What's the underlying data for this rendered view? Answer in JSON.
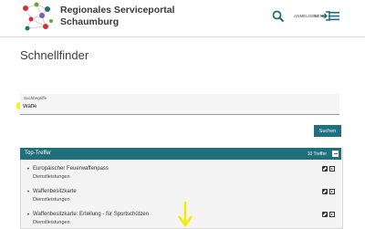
{
  "header": {
    "site_title": "Regionales Serviceportal Schaumburg",
    "login_label": "ANMELDEN",
    "menu_label": "MENÜ",
    "accent": "#1f6f7c"
  },
  "page": {
    "title": "Schnellfinder"
  },
  "search": {
    "label": "Suchbegriffe",
    "value": "Waffe"
  },
  "submit": {
    "label": "Suchen"
  },
  "results": {
    "title": "Top-Treffer",
    "count": "10 Treffer",
    "items": [
      {
        "title": "Europäischer Feuerwaffenpass",
        "category": "Dienstleistungen"
      },
      {
        "title": "Waffenbesitzkarte",
        "category": "Dienstleistungen"
      },
      {
        "title": "Waffenbesitzkarte: Erteilung - für Sportschützen",
        "category": "Dienstleistungen"
      }
    ]
  },
  "icons": {
    "logo": "network-logo-icon",
    "search": "search-icon",
    "login": "login-icon",
    "menu": "hamburger-menu-icon",
    "collapse": "collapse-minus-icon",
    "edit": "edit-icon",
    "open": "open-arrow-icon",
    "annotation": "yellow-arrow-down-icon"
  }
}
